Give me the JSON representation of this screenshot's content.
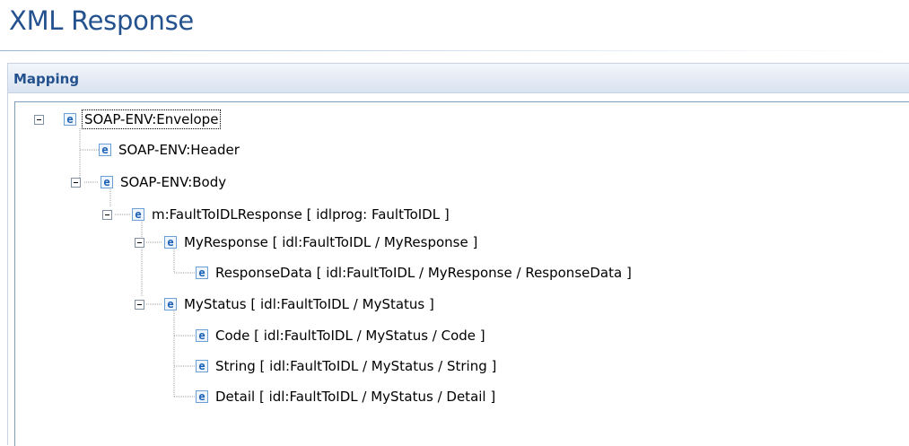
{
  "page": {
    "title": "XML Response"
  },
  "section": {
    "title": "Mapping"
  },
  "tree": {
    "envelope": {
      "icon": "e",
      "label": "SOAP-ENV:Envelope"
    },
    "header": {
      "icon": "e",
      "label": "SOAP-ENV:Header"
    },
    "body": {
      "icon": "e",
      "label": "SOAP-ENV:Body"
    },
    "fault_response": {
      "icon": "e",
      "label": "m:FaultToIDLResponse  [ idlprog: FaultToIDL ]"
    },
    "my_response": {
      "icon": "e",
      "label": "MyResponse  [ idl:FaultToIDL / MyResponse ]"
    },
    "response_data": {
      "icon": "e",
      "label": "ResponseData  [ idl:FaultToIDL / MyResponse / ResponseData ]"
    },
    "my_status": {
      "icon": "e",
      "label": "MyStatus  [ idl:FaultToIDL / MyStatus ]"
    },
    "code": {
      "icon": "e",
      "label": "Code  [ idl:FaultToIDL / MyStatus / Code ]"
    },
    "string": {
      "icon": "e",
      "label": "String  [ idl:FaultToIDL / MyStatus / String ]"
    },
    "detail": {
      "icon": "e",
      "label": "Detail  [ idl:FaultToIDL / MyStatus / Detail ]"
    }
  },
  "colors": {
    "accent": "#24528f",
    "icon": "#1a5fb4"
  }
}
